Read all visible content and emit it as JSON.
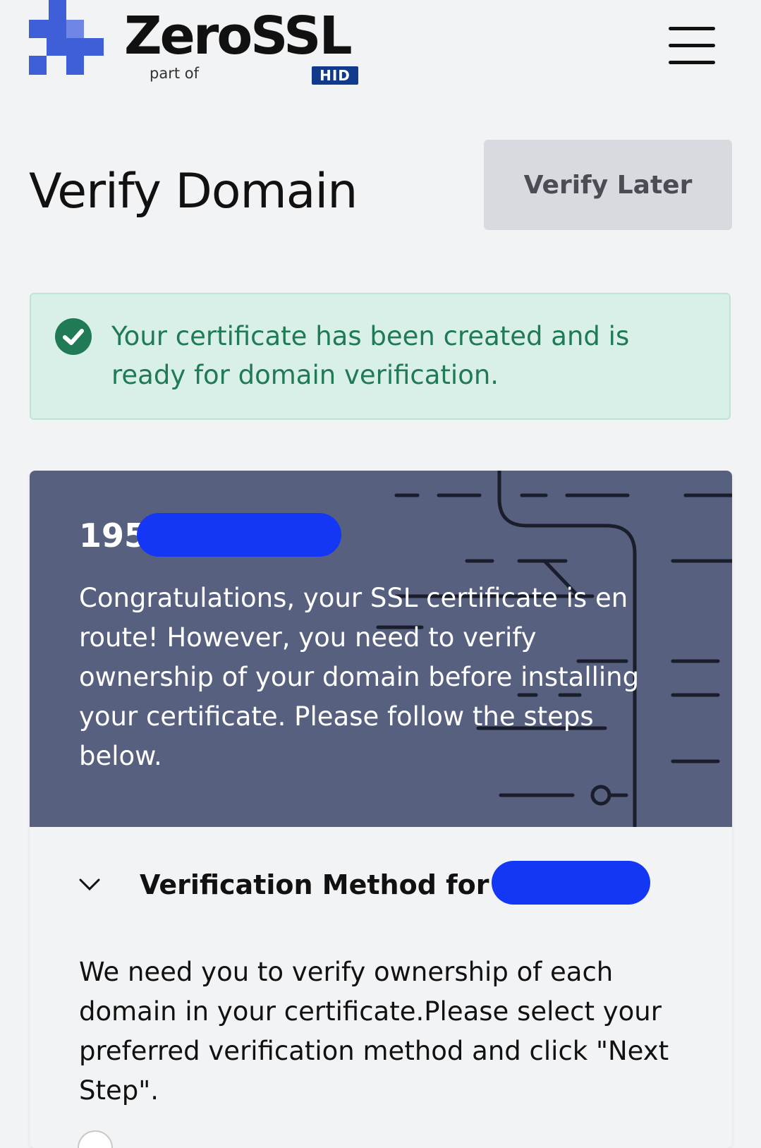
{
  "header": {
    "logo_text": "ZeroSSL",
    "logo_sub": "part of",
    "logo_badge": "HID",
    "menu_icon": "hamburger-menu-icon"
  },
  "page": {
    "title": "Verify Domain",
    "verify_later_label": "Verify Later"
  },
  "alert": {
    "icon": "check-circle-icon",
    "message": "Your certificate has been created and is ready for domain verification.",
    "color": "#1f7a55"
  },
  "card": {
    "domain_visible": "195",
    "message": "Congratulations, your SSL certificate is en route! However, you need to verify ownership of your domain before installing your certificate. Please follow the steps below."
  },
  "verification": {
    "section_title": "Verification Method for 195",
    "chevron_icon": "chevron-down-icon",
    "instructions": "We need you to verify ownership of each domain in your certificate.Please select your preferred verification method and click \"Next Step\"."
  },
  "colors": {
    "brand_blue": "#3f5fd8",
    "card_header": "#57607f",
    "alert_bg": "#d8f0e7",
    "redaction": "#1437f5"
  }
}
